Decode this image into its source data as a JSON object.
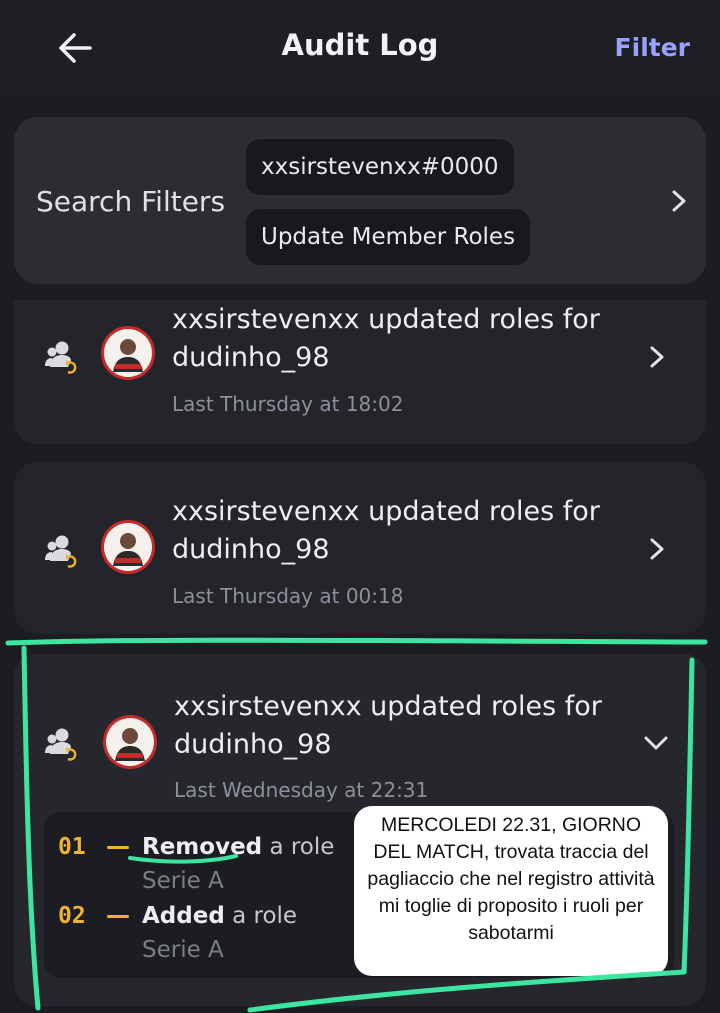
{
  "header": {
    "title": "Audit Log",
    "filter_label": "Filter"
  },
  "search_filters": {
    "label": "Search Filters",
    "user_chip": "xxsirstevenxx#0000",
    "action_chip": "Update Member Roles"
  },
  "entries": [
    {
      "text": "xxsirstevenxx updated roles for dudinho_98",
      "time": "Last Thursday at 18:02"
    },
    {
      "text": "xxsirstevenxx updated roles for dudinho_98",
      "time": "Last Thursday at 00:18"
    },
    {
      "text": "xxsirstevenxx updated roles for dudinho_98",
      "time": "Last Wednesday at 22:31",
      "changes": [
        {
          "num": "01",
          "dash": "—",
          "verb": "Removed",
          "rest": " a role",
          "role": "Serie A"
        },
        {
          "num": "02",
          "dash": "—",
          "verb": "Added",
          "rest": " a role",
          "role": "Serie A"
        }
      ]
    }
  ],
  "annotation": "MERCOLEDI 22.31, GIORNO DEL MATCH, trovata traccia del pagliaccio che nel registro attività mi toglie di proposito i ruoli per sabotarmi",
  "colors": {
    "accent": "#9aa1ff",
    "highlight": "#3de6a0",
    "number": "#f0b232",
    "avatar": "#c62a2a"
  },
  "icons": [
    "arrow-left-icon",
    "chevron-right-icon",
    "members-role-update-icon",
    "chevron-down-icon"
  ]
}
